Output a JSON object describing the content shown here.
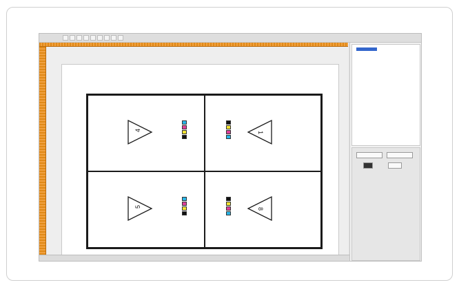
{
  "toolbar": {
    "buttons": [
      "",
      "",
      "",
      "",
      "",
      "",
      "",
      "",
      ""
    ]
  },
  "pages": {
    "top_left": "4",
    "top_right": "1",
    "bottom_left": "5",
    "bottom_right": "8"
  },
  "colors": {
    "ruler": "#e08a18",
    "cyan": "#29b6e8",
    "magenta": "#e0409a",
    "yellow": "#f4e431",
    "black": "#111111",
    "selection": "#3366cc"
  },
  "icons": [
    "triangle-page-marker",
    "color-bar-swatch"
  ],
  "right_panel": {
    "tree_rows": [
      "",
      "",
      ""
    ],
    "buttons": [
      "",
      "",
      "",
      ""
    ]
  },
  "status": {
    "fields": [
      "",
      "",
      "",
      "",
      "",
      ""
    ]
  }
}
